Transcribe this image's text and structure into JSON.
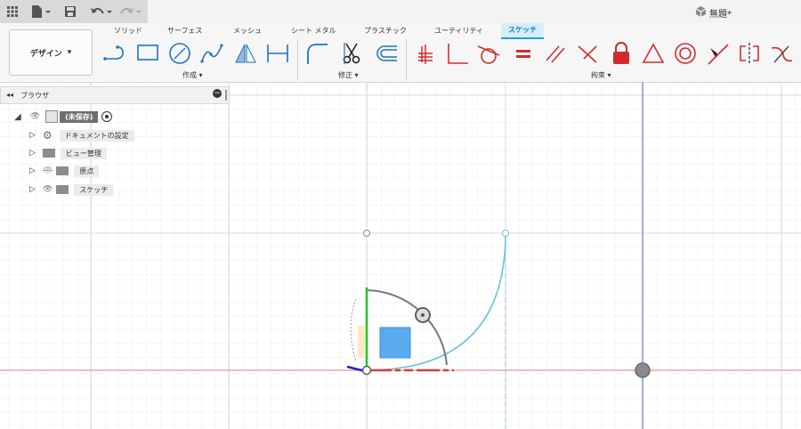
{
  "app": {
    "document_title": "無題*"
  },
  "workspace": {
    "label": "デザイン"
  },
  "tabs": [
    {
      "label": "ソリッド"
    },
    {
      "label": "サーフェス"
    },
    {
      "label": "メッシュ"
    },
    {
      "label": "シート メタル"
    },
    {
      "label": "プラスチック"
    },
    {
      "label": "ユーティリティ"
    },
    {
      "label": "スケッチ",
      "active": true
    }
  ],
  "groups": {
    "create": "作成",
    "modify": "修正",
    "constraints": "拘束"
  },
  "browser": {
    "title": "ブラウザ",
    "root": "(未保存)",
    "items": [
      {
        "label": "ドキュメントの設定",
        "icon": "gear-icon"
      },
      {
        "label": "ビュー管理",
        "icon": "folder-icon"
      },
      {
        "label": "原点",
        "icon": "folder-icon"
      },
      {
        "label": "スケッチ",
        "icon": "folder-icon"
      }
    ]
  },
  "colors": {
    "accent": "#1f9fe0",
    "constraint": "#d22b2b",
    "curve": "#6fbfdd",
    "x_axis": "#e03a3a",
    "y_axis": "#24c424"
  }
}
